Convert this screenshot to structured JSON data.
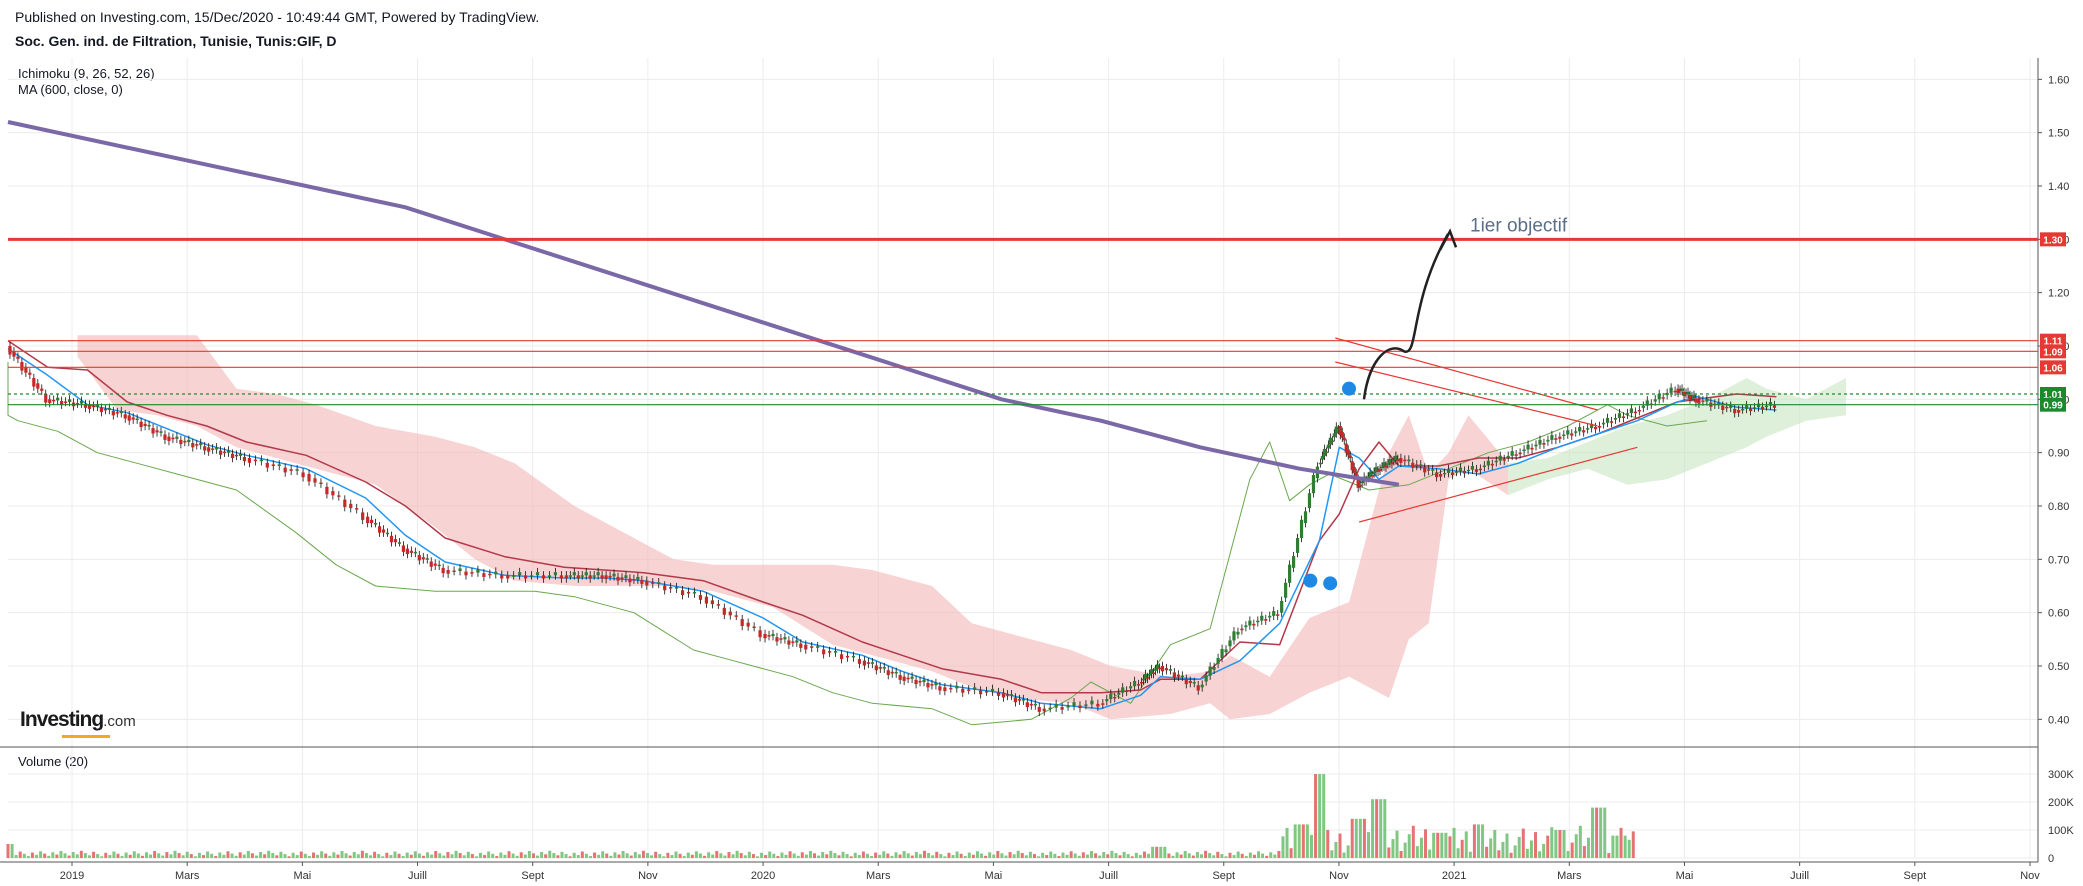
{
  "header": {
    "published": "Published on Investing.com, 15/Dec/2020 - 10:49:44 GMT, Powered by TradingView.",
    "symbol": "Soc. Gen. ind. de Filtration, Tunisie, Tunis:GIF, D"
  },
  "indicators": {
    "ichimoku": "Ichimoku (9, 26, 52, 26)",
    "ma": "MA (600, close, 0)",
    "volume": "Volume (20)"
  },
  "logo": {
    "main": "Investing",
    "suffix": ".com"
  },
  "annotation": "1ier objectif",
  "colors": {
    "ma": "#7b68a6",
    "tenkan": "#2196f3",
    "kijun": "#b2394a",
    "chikou": "#6aa84f",
    "cloud_bear": "#f4b6b6",
    "cloud_bull": "#c8e6c0",
    "resistance": "#e53935",
    "support": "#1b8a2e",
    "up": "#2e7d32",
    "down": "#c62828"
  },
  "chart_data": {
    "type": "line",
    "title": "Soc. Gen. ind. de Filtration, Tunisie, Tunis:GIF, D",
    "x_axis": {
      "labels": [
        "2019",
        "Mars",
        "Mai",
        "Juill",
        "Sept",
        "Nov",
        "2020",
        "Mars",
        "Mai",
        "Juill",
        "Sept",
        "Nov",
        "2021",
        "Mars",
        "Mai",
        "Juill",
        "Sept",
        "Nov"
      ]
    },
    "y_axis": {
      "ticks": [
        "1.60",
        "1.50",
        "1.40",
        "1.30",
        "1.20",
        "1.10",
        "1.00",
        "0.90",
        "0.80",
        "0.70",
        "0.60",
        "0.50",
        "0.40"
      ],
      "ylim": [
        0.35,
        1.64
      ]
    },
    "price_levels": [
      {
        "label": "1.30",
        "value": 1.3,
        "kind": "resistance"
      },
      {
        "label": "1.11",
        "value": 1.11,
        "kind": "resistance"
      },
      {
        "label": "1.09",
        "value": 1.09,
        "kind": "resistance"
      },
      {
        "label": "1.06",
        "value": 1.06,
        "kind": "resistance"
      },
      {
        "label": "1.01",
        "value": 1.01,
        "kind": "support"
      },
      {
        "label": "0.99",
        "value": 0.99,
        "kind": "support"
      }
    ],
    "close_series": {
      "t": [
        0.0,
        0.02,
        0.04,
        0.06,
        0.08,
        0.1,
        0.12,
        0.15,
        0.18,
        0.2,
        0.22,
        0.25,
        0.28,
        0.3,
        0.32,
        0.35,
        0.38,
        0.4,
        0.43,
        0.45,
        0.47,
        0.5,
        0.52,
        0.55,
        0.57,
        0.58,
        0.6,
        0.62,
        0.64,
        0.66,
        0.67,
        0.68,
        0.69,
        0.7,
        0.72,
        0.74,
        0.76,
        0.78,
        0.8,
        0.82,
        0.84,
        0.85,
        0.87,
        0.89
      ],
      "close": [
        1.1,
        1.0,
        0.99,
        0.97,
        0.93,
        0.91,
        0.89,
        0.86,
        0.78,
        0.72,
        0.68,
        0.67,
        0.67,
        0.67,
        0.66,
        0.63,
        0.56,
        0.54,
        0.51,
        0.48,
        0.46,
        0.45,
        0.42,
        0.43,
        0.47,
        0.5,
        0.46,
        0.57,
        0.6,
        0.88,
        0.95,
        0.84,
        0.87,
        0.89,
        0.86,
        0.87,
        0.9,
        0.93,
        0.95,
        0.98,
        1.02,
        1.0,
        0.98,
        0.99
      ]
    },
    "ma600": {
      "t": [
        0.0,
        0.1,
        0.2,
        0.3,
        0.4,
        0.5,
        0.55,
        0.6,
        0.65,
        0.7
      ],
      "values": [
        1.52,
        1.44,
        1.36,
        1.24,
        1.12,
        1.0,
        0.96,
        0.91,
        0.87,
        0.84
      ]
    },
    "annotation_target": {
      "value": 1.31
    },
    "volume": {
      "ticks": [
        "300K",
        "200K",
        "100K",
        "0"
      ],
      "max": 350000,
      "peaks": [
        {
          "t": 0.0,
          "v": 50000
        },
        {
          "t": 0.58,
          "v": 40000
        },
        {
          "t": 0.65,
          "v": 120000
        },
        {
          "t": 0.66,
          "v": 300000
        },
        {
          "t": 0.68,
          "v": 140000
        },
        {
          "t": 0.69,
          "v": 210000
        },
        {
          "t": 0.72,
          "v": 90000
        },
        {
          "t": 0.74,
          "v": 120000
        },
        {
          "t": 0.78,
          "v": 100000
        },
        {
          "t": 0.8,
          "v": 180000
        },
        {
          "t": 0.81,
          "v": 80000
        }
      ]
    }
  }
}
